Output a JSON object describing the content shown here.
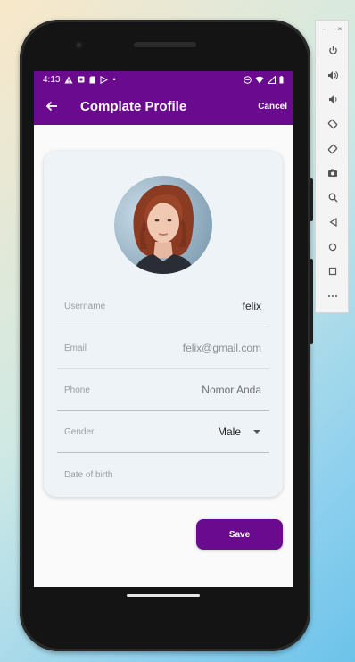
{
  "emulator_toolbar": {
    "minimize_icon": "–",
    "close_icon": "×",
    "buttons": [
      "power-icon",
      "volume-up-icon",
      "volume-down-icon",
      "rotate-left-icon",
      "rotate-right-icon",
      "camera-icon",
      "zoom-icon",
      "back-icon",
      "home-icon",
      "overview-icon",
      "more-icon"
    ]
  },
  "status_bar": {
    "time": "4:13",
    "left_icons": [
      "warning-icon",
      "notification-icon",
      "sd-card-icon",
      "play-store-icon",
      "dot-icon"
    ],
    "right_icons": [
      "dnd-icon",
      "wifi-icon",
      "signal-icon",
      "battery-icon"
    ]
  },
  "app_bar": {
    "title": "Complate Profile",
    "cancel_label": "Cancel",
    "color": "#6a0a8f"
  },
  "profile": {
    "username_label": "Username",
    "username_value": "felix",
    "email_label": "Email",
    "email_placeholder": "felix@gmail.com",
    "phone_label": "Phone",
    "phone_placeholder": "Nomor Anda",
    "gender_label": "Gender",
    "gender_value": "Male",
    "dob_label": "Date of birth"
  },
  "save_label": "Save"
}
